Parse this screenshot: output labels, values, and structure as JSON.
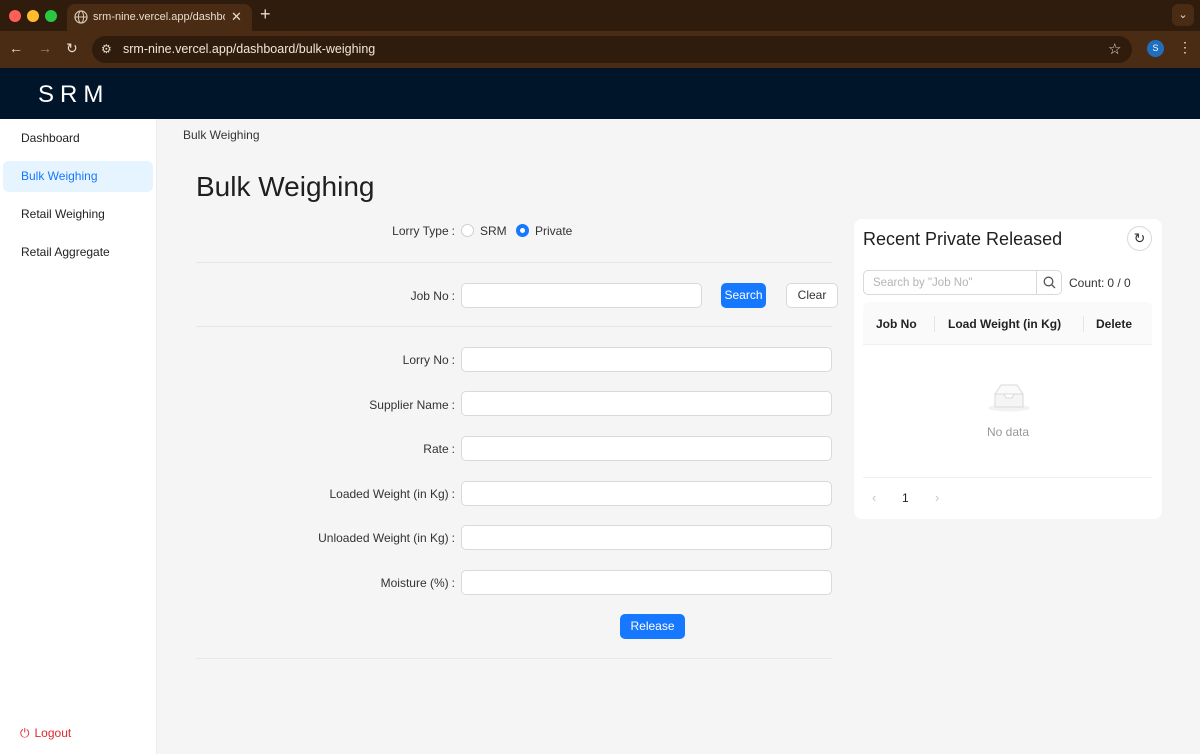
{
  "browser": {
    "tab_title": "srm-nine.vercel.app/dashboard/bulk-weighing",
    "url": "srm-nine.vercel.app/dashboard/bulk-weighing",
    "avatar_letter": "S"
  },
  "header": {
    "logo": "SRM"
  },
  "sidebar": {
    "items": [
      {
        "label": "Dashboard",
        "active": false
      },
      {
        "label": "Bulk Weighing",
        "active": true
      },
      {
        "label": "Retail Weighing",
        "active": false
      },
      {
        "label": "Retail Aggregate",
        "active": false
      }
    ],
    "logout_label": "Logout"
  },
  "breadcrumb": "Bulk Weighing",
  "page_title": "Bulk Weighing",
  "form": {
    "lorry_type_label": "Lorry Type",
    "lorry_type_options": [
      {
        "label": "SRM",
        "checked": false
      },
      {
        "label": "Private",
        "checked": true
      }
    ],
    "job_no_label": "Job No",
    "job_no_value": "",
    "search_button": "Search",
    "clear_button": "Clear",
    "fields": [
      {
        "label": "Lorry No",
        "value": ""
      },
      {
        "label": "Supplier Name",
        "value": ""
      },
      {
        "label": "Rate",
        "value": ""
      },
      {
        "label": "Loaded Weight (in Kg)",
        "value": ""
      },
      {
        "label": "Unloaded Weight (in Kg)",
        "value": ""
      },
      {
        "label": "Moisture (%)",
        "value": ""
      }
    ],
    "release_button": "Release"
  },
  "recent": {
    "title": "Recent Private Released",
    "search_placeholder": "Search by \"Job No\"",
    "count_label": "Count:",
    "count_value": "0 / 0",
    "columns": [
      "Job No",
      "Load Weight (in Kg)",
      "Delete"
    ],
    "empty_text": "No data",
    "page": "1"
  },
  "colors": {
    "header_bg": "#001529",
    "primary": "#1677ff",
    "logout": "#e0282e"
  }
}
